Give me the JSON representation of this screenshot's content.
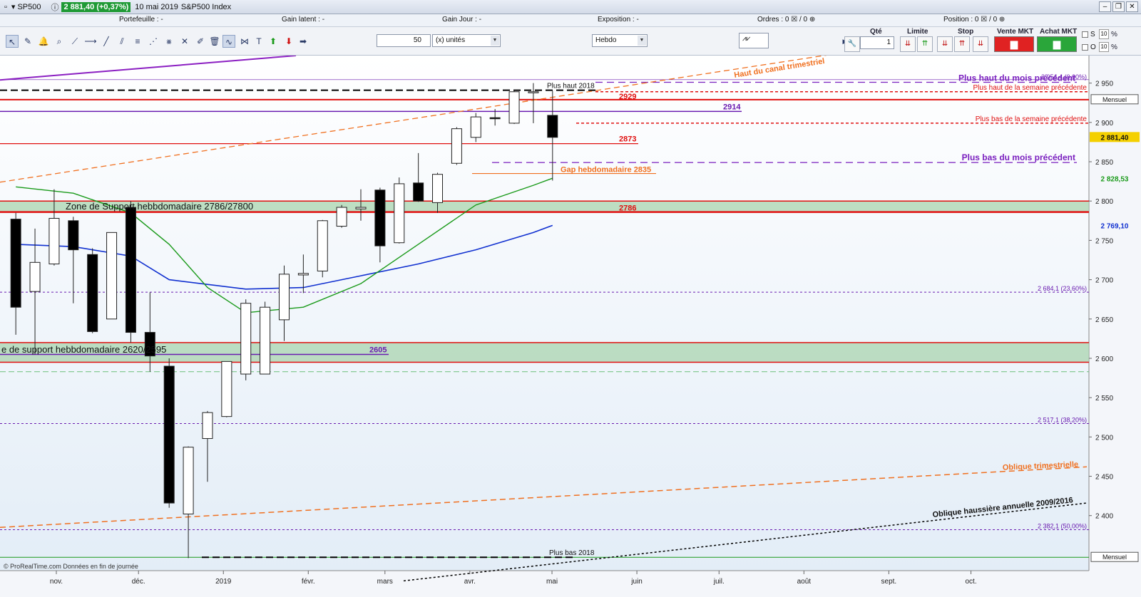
{
  "window": {
    "symbol": "SP500",
    "price_badge": "2 881,40 (+0,37%)",
    "date_label": "10 mai 2019",
    "instrument": "S&P500 Index"
  },
  "stats": {
    "portefeuille": "Portefeuille : -",
    "gain_latent": "Gain latent : -",
    "gain_jour": "Gain Jour : -",
    "exposition": "Exposition : -",
    "ordres": "Ordres : 0",
    "ordres_suffix": "/ 0",
    "position": "Position : 0",
    "position_suffix": "/ 0"
  },
  "toolbar": {
    "quantity": "50",
    "unit": "(x) unités",
    "timeframe": "Hebdo",
    "qte_label": "Qté",
    "qte_value": "1",
    "limite_label": "Limite",
    "stop_label": "Stop",
    "vente_label": "Vente MKT",
    "achat_label": "Achat MKT",
    "s_label": "S",
    "o_label": "O",
    "pct_label": "%"
  },
  "colors": {
    "up": "#ffffff",
    "down": "#000000",
    "ma_fast": "#1a9a1a",
    "ma_slow": "#1030d0",
    "support_zone": "#a9d4af",
    "resistance": "#e01010",
    "fib": "#6a1bb0",
    "orange": "#f07020",
    "last_price_bg": "#f4d000",
    "price_axis_green": "#1a9a1a",
    "price_axis_blue": "#1030d0"
  },
  "chart_data": {
    "type": "candlestick",
    "ylim": [
      2330,
      2985
    ],
    "y_ticks": [
      2400,
      2450,
      2500,
      2550,
      2600,
      2650,
      2700,
      2750,
      2800,
      2850,
      2900,
      2950
    ],
    "y_tick_labels": [
      "2 400",
      "2 450",
      "2 500",
      "2 550",
      "2 600",
      "2 650",
      "2 700",
      "2 750",
      "2 800",
      "2 850",
      "2 900",
      "2 950"
    ],
    "x_labels": [
      {
        "label": "nov.",
        "date": "2018-11-01"
      },
      {
        "label": "déc.",
        "date": "2018-12-01"
      },
      {
        "label": "2019",
        "date": "2019-01-01"
      },
      {
        "label": "févr.",
        "date": "2019-02-01"
      },
      {
        "label": "mars",
        "date": "2019-03-01"
      },
      {
        "label": "avr.",
        "date": "2019-04-01"
      },
      {
        "label": "mai",
        "date": "2019-05-01"
      },
      {
        "label": "juin",
        "date": "2019-06-01"
      },
      {
        "label": "juil.",
        "date": "2019-07-01"
      },
      {
        "label": "août",
        "date": "2019-08-01"
      },
      {
        "label": "sept.",
        "date": "2019-09-01"
      },
      {
        "label": "oct.",
        "date": "2019-10-01"
      }
    ],
    "candles": [
      {
        "date": "2018-10-15",
        "o": 2777,
        "h": 2785,
        "l": 2630,
        "c": 2665
      },
      {
        "date": "2018-10-22",
        "o": 2685,
        "h": 2765,
        "l": 2605,
        "c": 2722
      },
      {
        "date": "2018-10-29",
        "o": 2720,
        "h": 2815,
        "l": 2718,
        "c": 2778
      },
      {
        "date": "2018-11-05",
        "o": 2775,
        "h": 2780,
        "l": 2670,
        "c": 2738
      },
      {
        "date": "2018-11-12",
        "o": 2732,
        "h": 2740,
        "l": 2632,
        "c": 2634
      },
      {
        "date": "2018-11-19",
        "o": 2650,
        "h": 2760,
        "l": 2650,
        "c": 2760
      },
      {
        "date": "2018-11-26",
        "o": 2792,
        "h": 2800,
        "l": 2620,
        "c": 2633
      },
      {
        "date": "2018-12-03",
        "o": 2633,
        "h": 2684,
        "l": 2583,
        "c": 2603
      },
      {
        "date": "2018-12-10",
        "o": 2590,
        "h": 2600,
        "l": 2410,
        "c": 2416
      },
      {
        "date": "2018-12-17",
        "o": 2402,
        "h": 2488,
        "l": 2346,
        "c": 2487
      },
      {
        "date": "2018-12-24",
        "o": 2498,
        "h": 2533,
        "l": 2443,
        "c": 2531
      },
      {
        "date": "2018-12-31",
        "o": 2526,
        "h": 2596,
        "l": 2525,
        "c": 2596
      },
      {
        "date": "2019-01-07",
        "o": 2580,
        "h": 2675,
        "l": 2572,
        "c": 2670
      },
      {
        "date": "2019-01-14",
        "o": 2580,
        "h": 2672,
        "l": 2612,
        "c": 2665
      },
      {
        "date": "2019-01-21",
        "o": 2649,
        "h": 2718,
        "l": 2622,
        "c": 2707
      },
      {
        "date": "2019-01-28",
        "o": 2706,
        "h": 2732,
        "l": 2683,
        "c": 2708
      },
      {
        "date": "2019-02-04",
        "o": 2711,
        "h": 2776,
        "l": 2703,
        "c": 2775
      },
      {
        "date": "2019-02-11",
        "o": 2768,
        "h": 2795,
        "l": 2766,
        "c": 2792
      },
      {
        "date": "2019-02-18",
        "o": 2790,
        "h": 2815,
        "l": 2775,
        "c": 2792
      },
      {
        "date": "2019-02-25",
        "o": 2814,
        "h": 2817,
        "l": 2722,
        "c": 2743
      },
      {
        "date": "2019-03-04",
        "o": 2747,
        "h": 2830,
        "l": 2746,
        "c": 2822
      },
      {
        "date": "2019-03-11",
        "o": 2823,
        "h": 2861,
        "l": 2799,
        "c": 2800
      },
      {
        "date": "2019-03-18",
        "o": 2798,
        "h": 2836,
        "l": 2785,
        "c": 2834
      },
      {
        "date": "2019-03-25",
        "o": 2848,
        "h": 2894,
        "l": 2846,
        "c": 2892
      },
      {
        "date": "2019-04-01",
        "o": 2881,
        "h": 2912,
        "l": 2875,
        "c": 2907
      },
      {
        "date": "2019-04-08",
        "o": 2906,
        "h": 2917,
        "l": 2896,
        "c": 2905
      },
      {
        "date": "2019-04-15",
        "o": 2899,
        "h": 2940,
        "l": 2898,
        "c": 2939
      },
      {
        "date": "2019-04-22",
        "o": 2939,
        "h": 2950,
        "l": 2899,
        "c": 2939
      },
      {
        "date": "2019-04-29",
        "o": 2909,
        "h": 2940,
        "l": 2826,
        "c": 2881
      }
    ],
    "ma_fast_label": "2 828,53",
    "ma_fast": [
      {
        "date": "2018-10-15",
        "v": 2818
      },
      {
        "date": "2018-11-05",
        "v": 2810
      },
      {
        "date": "2018-11-26",
        "v": 2785
      },
      {
        "date": "2018-12-10",
        "v": 2745
      },
      {
        "date": "2018-12-24",
        "v": 2690
      },
      {
        "date": "2019-01-07",
        "v": 2658
      },
      {
        "date": "2019-01-28",
        "v": 2665
      },
      {
        "date": "2019-02-18",
        "v": 2695
      },
      {
        "date": "2019-03-11",
        "v": 2745
      },
      {
        "date": "2019-04-01",
        "v": 2795
      },
      {
        "date": "2019-04-22",
        "v": 2820
      },
      {
        "date": "2019-04-29",
        "v": 2829
      }
    ],
    "ma_slow_label": "2 769,10",
    "ma_slow": [
      {
        "date": "2018-10-15",
        "v": 2745
      },
      {
        "date": "2018-11-05",
        "v": 2742
      },
      {
        "date": "2018-11-26",
        "v": 2730
      },
      {
        "date": "2018-12-10",
        "v": 2700
      },
      {
        "date": "2019-01-07",
        "v": 2688
      },
      {
        "date": "2019-01-28",
        "v": 2690
      },
      {
        "date": "2019-02-18",
        "v": 2705
      },
      {
        "date": "2019-03-11",
        "v": 2720
      },
      {
        "date": "2019-04-01",
        "v": 2738
      },
      {
        "date": "2019-04-22",
        "v": 2760
      },
      {
        "date": "2019-04-29",
        "v": 2769
      }
    ],
    "last_price_label": "2 881,40",
    "mensuel_label": "Mensuel",
    "annotations": {
      "zone_top": "Zone de Support hebbdomadaire 2786/27800",
      "zone_bottom": "e de support hebbdomadaire 2620/2595",
      "plus_haut_2018": "Plus haut 2018",
      "plus_bas_2018": "Plus bas 2018",
      "v2929": "2929",
      "v2914": "2914",
      "v2873": "2873",
      "v2786": "2786",
      "v2605": "2605",
      "gap": "Gap hebdomadaire 2835",
      "canal": "Haut du canal trimestriel",
      "oblique_trim": "Oblique trimestrielle",
      "oblique_annuelle": "Oblique haussière annuelle 2009/2016",
      "plus_haut_mois": "Plus haut du mois précédent",
      "plus_haut_semaine": "Plus haut de la semaine précédente",
      "plus_bas_semaine": "Plus bas de la semaine précédente",
      "plus_bas_mois": "Plus bas du mois précédent",
      "fib_0": "2 954,4 (0,00%)",
      "fib_236": "2 684,1 (23,60%)",
      "fib_382": "2 517,1 (38,20%)",
      "fib_50": "2 382,1 (50,00%)",
      "credit": "© ProRealTime.com  Données en fin de journée"
    }
  }
}
